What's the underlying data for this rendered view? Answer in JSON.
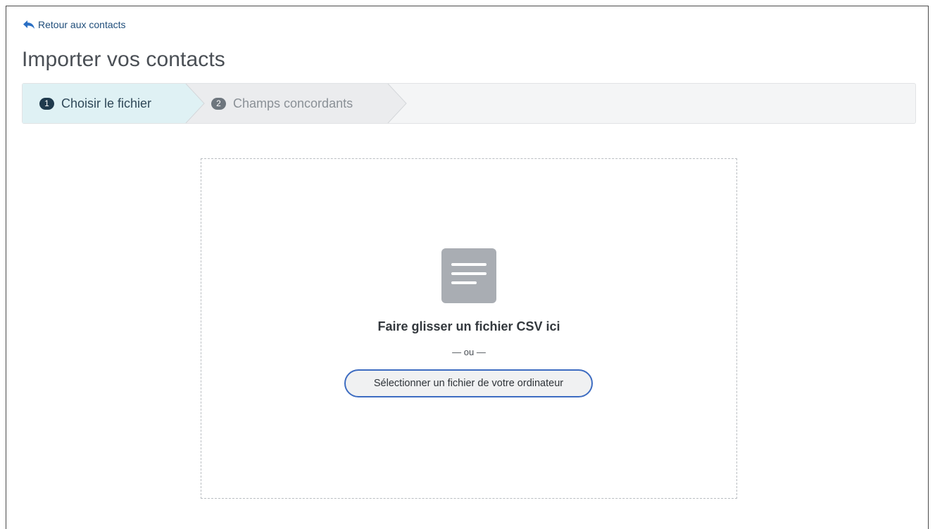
{
  "nav": {
    "back_label": "Retour aux contacts",
    "back_icon": "reply-arrow-icon"
  },
  "page": {
    "title": "Importer vos contacts"
  },
  "stepper": {
    "steps": [
      {
        "number": "1",
        "label": "Choisir le fichier",
        "state": "active"
      },
      {
        "number": "2",
        "label": "Champs concordants",
        "state": "inactive"
      }
    ]
  },
  "dropzone": {
    "icon": "document-icon",
    "instruction": "Faire glisser un fichier CSV ici",
    "separator": "— ou —",
    "button_label": "Sélectionner un fichier de votre ordinateur"
  },
  "colors": {
    "active_step_bg": "#dff1f4",
    "inactive_step_bg": "#ebecee",
    "button_border": "#3d6cc1",
    "link": "#1f4d7a"
  }
}
